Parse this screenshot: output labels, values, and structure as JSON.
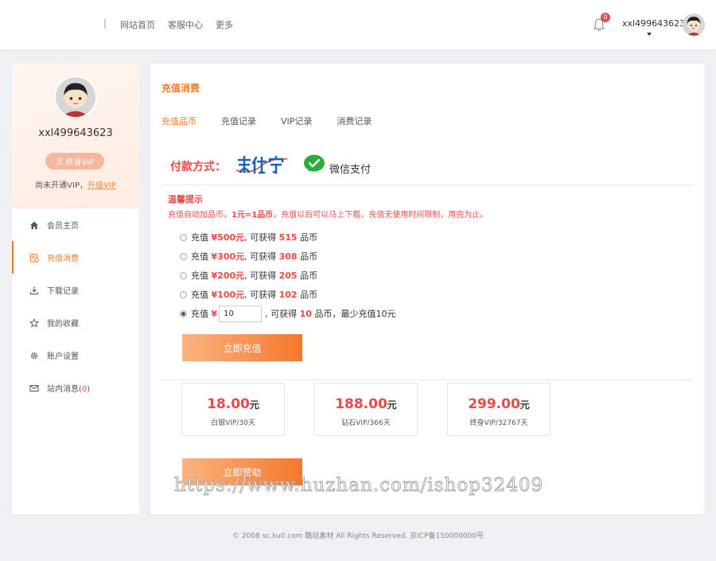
{
  "header": {
    "separator": "|",
    "nav": [
      "网站首页",
      "客服中心",
      "更多"
    ],
    "notification_count": "0",
    "username": "xxl499643623"
  },
  "sidebar": {
    "username": "xxl499643623",
    "vip_button": "终身VIP",
    "vip_tip": "尚未开通VIP，",
    "upgrade_link": "升级VIP",
    "menu": [
      {
        "label": "会员主页",
        "icon": "home-icon"
      },
      {
        "label": "充值消费",
        "icon": "recharge-icon",
        "active": true
      },
      {
        "label": "下载记录",
        "icon": "download-icon"
      },
      {
        "label": "我的收藏",
        "icon": "star-icon"
      },
      {
        "label": "账户设置",
        "icon": "gear-icon"
      },
      {
        "label": "站内消息(",
        "count": "0",
        "close": ")",
        "icon": "mail-icon"
      }
    ]
  },
  "main": {
    "title": "充值消费",
    "tabs": [
      "充值品币",
      "充值记录",
      "VIP记录",
      "消费记录"
    ],
    "pay_label": "付款方式：",
    "wechat_label": "微信支付",
    "notice_title": "温馨提示",
    "notice_prefix": "充值自动加品币，",
    "notice_bold": "1元=1品币",
    "notice_suffix": "，充值以后可以马上下载，充值无使用时间限制，用完为止。",
    "options": [
      {
        "pre": "充值",
        "money": "¥500元",
        "mid": ", 可获得",
        "num": "515",
        "unit": "品币"
      },
      {
        "pre": "充值",
        "money": "¥300元",
        "mid": ", 可获得",
        "num": "308",
        "unit": "品币"
      },
      {
        "pre": "充值",
        "money": "¥200元",
        "mid": ", 可获得",
        "num": "205",
        "unit": "品币"
      },
      {
        "pre": "充值",
        "money": "¥100元",
        "mid": ", 可获得",
        "num": "102",
        "unit": "品币"
      }
    ],
    "custom": {
      "pre": "充值",
      "money": "¥",
      "value": "10",
      "mid": ", 可获得",
      "num": "10",
      "unit": "品币，最少充值10元"
    },
    "charge_button": "立即充值",
    "vip_cards": [
      {
        "price": "18.00",
        "unit": "元",
        "label": "白银VIP/30天"
      },
      {
        "price": "188.00",
        "unit": "元",
        "label": "钻石VIP/366天"
      },
      {
        "price": "299.00",
        "unit": "元",
        "label": "终身VIP/32767天"
      }
    ],
    "sponsor_button": "立即赞助"
  },
  "watermark": "https://www.huzhan.com/ishop32409",
  "footer": "© 2008 sc.ku0.com 酷站素材 All Rights Reserved. 京ICP备150000000号",
  "colors": {
    "accent": "#f07a2a",
    "price_red": "#f04848"
  }
}
